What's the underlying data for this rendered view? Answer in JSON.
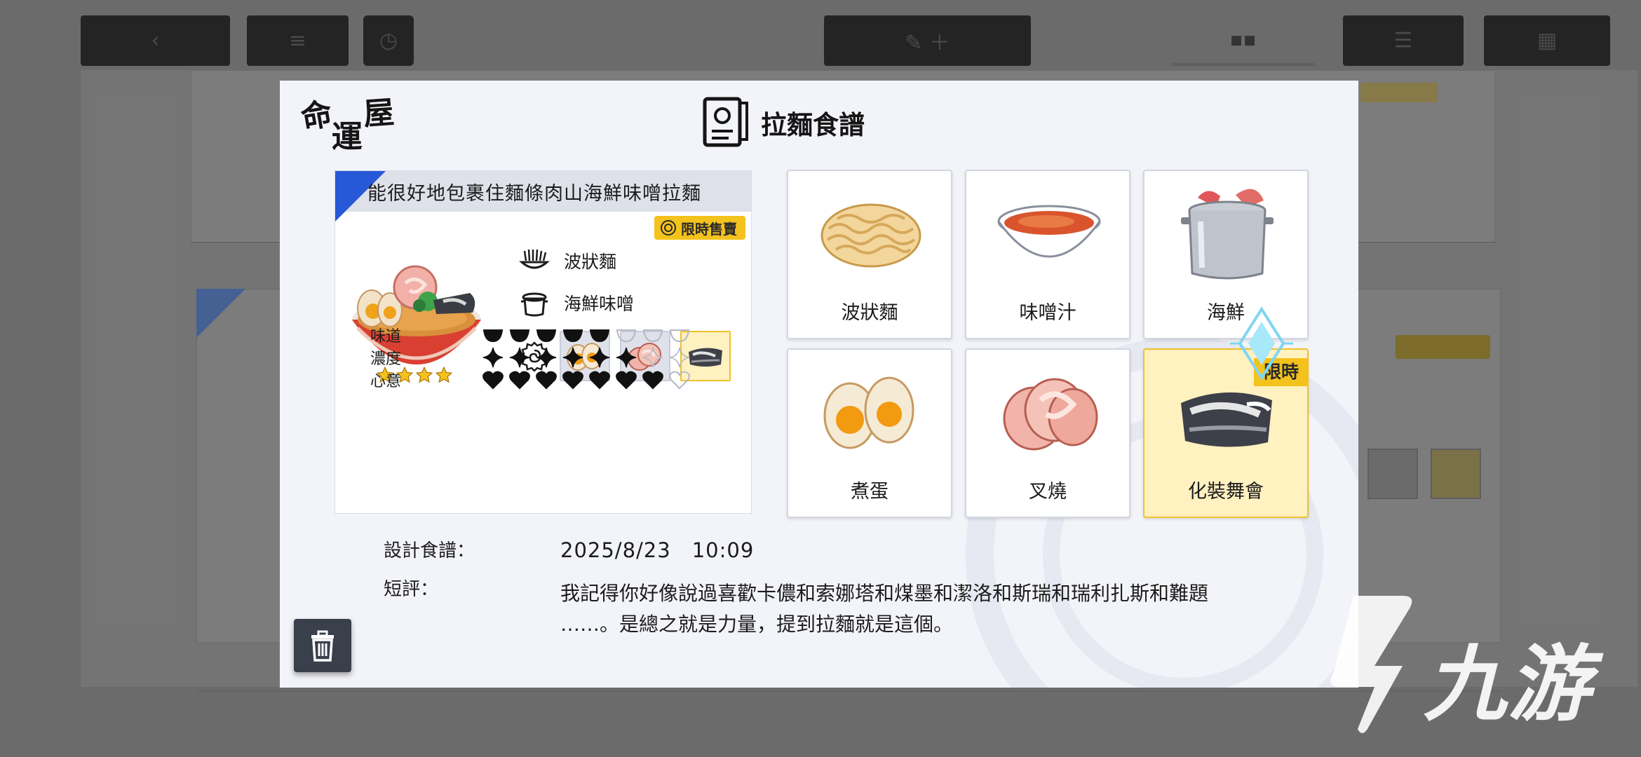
{
  "brand": {
    "logo_text": "命運屋"
  },
  "dialog": {
    "title": "拉麵食譜",
    "recipe_name": "能很好地包裹住麵條肉山海鮮味噌拉麵",
    "limited_badge": "限時售賣",
    "noodle_type": "波狀麵",
    "soup_type": "海鮮味噌",
    "stars": 4,
    "stats": [
      {
        "label": "味道",
        "filled": 5,
        "total": 8,
        "icon": "bowl-icon"
      },
      {
        "label": "濃度",
        "filled": 6,
        "total": 8,
        "icon": "sparkle-icon"
      },
      {
        "label": "心意",
        "filled": 7,
        "total": 8,
        "icon": "heart-icon"
      }
    ],
    "design_label": "設計食譜：",
    "design_value": "2025/8/23　10:09",
    "comment_label": "短評：",
    "comment_line1": "我記得你好像說過喜歡卡儂和索娜塔和煤墨和潔洛和斯瑞和瑞利扎斯和難題",
    "comment_line2": "……。是總之就是力量，提到拉麵就是這個。"
  },
  "ingredients": [
    {
      "name": "波狀麵",
      "icon": "wavy-noodles-icon",
      "selected": false
    },
    {
      "name": "味噌汁",
      "icon": "miso-soup-icon",
      "selected": false
    },
    {
      "name": "海鮮",
      "icon": "seafood-pot-icon",
      "selected": false
    },
    {
      "name": "煮蛋",
      "icon": "boiled-egg-icon",
      "selected": false
    },
    {
      "name": "叉燒",
      "icon": "chashu-icon",
      "selected": false
    },
    {
      "name": "化裝舞會",
      "icon": "masquerade-icon",
      "selected": true,
      "ribbon": "限時"
    }
  ],
  "watermark": {
    "text": "九游"
  },
  "colors": {
    "accent_blue": "#2758d8",
    "limited_yellow": "#f4c21c",
    "dialog_bg": "#f3f4f9"
  }
}
